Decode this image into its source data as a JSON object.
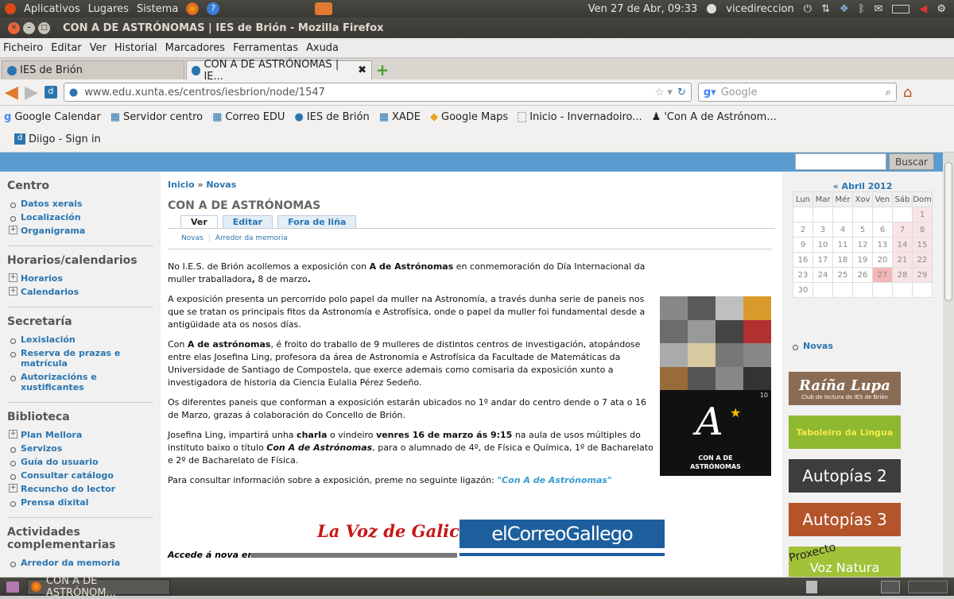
{
  "top_panel": {
    "menus": [
      "Aplicativos",
      "Lugares",
      "Sistema"
    ],
    "clock": "Ven 27 de Abr, 09:33",
    "user": "vicedireccion"
  },
  "window": {
    "title": "CON A DE ASTRÓNOMAS | IES de Brión - Mozilla Firefox"
  },
  "menubar": [
    "Ficheiro",
    "Editar",
    "Ver",
    "Historial",
    "Marcadores",
    "Ferramentas",
    "Axuda"
  ],
  "tabs": [
    {
      "label": "IES de Brión",
      "active": false
    },
    {
      "label": "CON A DE ASTRÓNOMAS | IE...",
      "active": true
    }
  ],
  "nav": {
    "url": "www.edu.xunta.es/centros/iesbrion/node/1547",
    "search_placeholder": "Google"
  },
  "bookmarks": [
    "Google Calendar",
    "Servidor centro",
    "Correo EDU",
    "IES de Brión",
    "XADE",
    "Google Maps",
    "Inicio - Invernadoiro...",
    "'Con A de Astrónom...",
    "Diigo - Sign in"
  ],
  "site_search": {
    "button": "Buscar",
    "value": ""
  },
  "sidebar": {
    "centro": {
      "title": "Centro",
      "items": [
        "Datos xerais",
        "Localización",
        "Organigrama"
      ]
    },
    "horarios": {
      "title": "Horarios/calendarios",
      "items": [
        "Horarios",
        "Calendarios"
      ]
    },
    "secretaria": {
      "title": "Secretaría",
      "items": [
        "Lexislación",
        "Reserva de prazas e matrícula",
        "Autorizacións e xustificantes"
      ]
    },
    "biblioteca": {
      "title": "Biblioteca",
      "items": [
        "Plan Mellora",
        "Servizos",
        "Guía do usuario",
        "Consultar catálogo",
        "Recuncho do lector",
        "Prensa dixital"
      ]
    },
    "actividades": {
      "title": "Actividades complementarias",
      "items": [
        "Arredor da memoria"
      ]
    }
  },
  "breadcrumb": {
    "home": "Inicio",
    "sep": "»",
    "current": "Novas"
  },
  "node": {
    "title": "CON A DE ASTRÓNOMAS",
    "tabs": [
      "Ver",
      "Editar",
      "Fora de liña"
    ],
    "terms": [
      "Novas",
      "Arredor da memoria"
    ],
    "paragraphs": [
      [
        "No I.E.S. de Brión acollemos a exposición con ",
        "A de Astrónomas",
        " en conmemoración do Día Internacional da muller traballadora",
        ",",
        " 8 de marzo",
        "."
      ],
      [
        "A exposición presenta un percorrido polo papel da muller na Astronomía, a través dunha serie de paneis nos que se tratan os principais fitos da Astronomía e Astrofísica, onde o papel da muller foi fundamental desde a antigüidade ata os nosos días."
      ],
      [
        "Con ",
        "A de astrónomas",
        ", é froito do traballo de 9 mulleres de distintos centros de investigación, atopándose entre elas Josefina Ling, profesora da área de Astronomía e Astrofísica da Facultade de Matemáticas da Universidade de Santiago de Compostela, que exerce ademais como comisaria da exposición xunto a investigadora de historia da Ciencia Eulalia Pérez Sedeño."
      ],
      [
        "Os diferentes paneis que conforman a exposición estarán ubicados no 1º andar do centro dende o 7 ata o 16 de Marzo, grazas á colaboración do Concello de Brión."
      ],
      [
        "Josefina Ling, impartirá unha ",
        "charla",
        " o vindeiro ",
        "venres 16 de marzo ás 9:15",
        "  na aula de usos múltiples do instituto baixo o título ",
        "Con A de Astrónomas",
        ", para o alumnado de 4º, de Física e Química, 1º de Bacharelato e 2º de Bacharelato de Física."
      ],
      [
        "Para consultar información sobre a exposición, preme no seguinte ligazón: ",
        "\"Con A de Astrónomas\""
      ]
    ],
    "poster_text": "CON A DE ASTRÓNOMAS",
    "poster_letter": "A",
    "poster_badge": "10",
    "press_label": "Accede á nova en",
    "press_logos": [
      "La Voz de Galicia",
      "elCorreoGallego"
    ]
  },
  "calendar": {
    "title": "« Abril 2012",
    "days": [
      "Lun",
      "Mar",
      "Mér",
      "Xov",
      "Ven",
      "Sáb",
      "Dom"
    ],
    "weeks": [
      [
        "",
        "",
        "",
        "",
        "",
        "",
        "1"
      ],
      [
        "2",
        "3",
        "4",
        "5",
        "6",
        "7",
        "8"
      ],
      [
        "9",
        "10",
        "11",
        "12",
        "13",
        "14",
        "15"
      ],
      [
        "16",
        "17",
        "18",
        "19",
        "20",
        "21",
        "22"
      ],
      [
        "23",
        "24",
        "25",
        "26",
        "27",
        "28",
        "29"
      ],
      [
        "30",
        "",
        "",
        "",
        "",
        "",
        ""
      ]
    ],
    "today": "27"
  },
  "right_menu": [
    "Novas"
  ],
  "banners": [
    {
      "label": "Raíña Lupa",
      "sub": "Club de lectura do IES de Brión",
      "color": "#8a6b53"
    },
    {
      "label": "Taboleiro da Lingua",
      "color": "#8db82f"
    },
    {
      "label": "Autopías 2",
      "color": "#3d3d3d"
    },
    {
      "label": "Autopías 3",
      "color": "#b4542a"
    },
    {
      "label": "Voz Natura",
      "tag": "Proxecto",
      "color": "#a2c23a"
    }
  ],
  "taskbar": {
    "window": "CON A DE ASTRÓNOM..."
  }
}
